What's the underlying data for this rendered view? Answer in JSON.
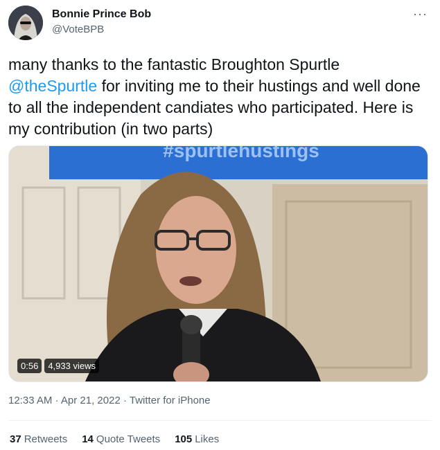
{
  "author": {
    "name": "Bonnie Prince Bob",
    "handle": "@VoteBPB",
    "avatar_icon": "avatar-image"
  },
  "more_icon": "ellipsis-icon",
  "tweet": {
    "text_before": "many thanks to the fantastic Broughton Spurtle ",
    "mention": "@theSpurtle",
    "text_after": " for inviting me to their hustings and well done to all the independent candiates who participated. Here is my contribution (in two parts)"
  },
  "media": {
    "screen_text": "#spurtlehustings",
    "duration": "0:56",
    "views": "4,933 views"
  },
  "meta": {
    "time": "12:33 AM",
    "separator": "·",
    "date": "Apr 21, 2022",
    "source": "Twitter for iPhone"
  },
  "stats": {
    "retweets_count": "37",
    "retweets_label": "Retweets",
    "quotes_count": "14",
    "quotes_label": "Quote Tweets",
    "likes_count": "105",
    "likes_label": "Likes"
  },
  "colors": {
    "link": "#1d9bf0",
    "secondary": "#536471",
    "text": "#0f1419"
  }
}
